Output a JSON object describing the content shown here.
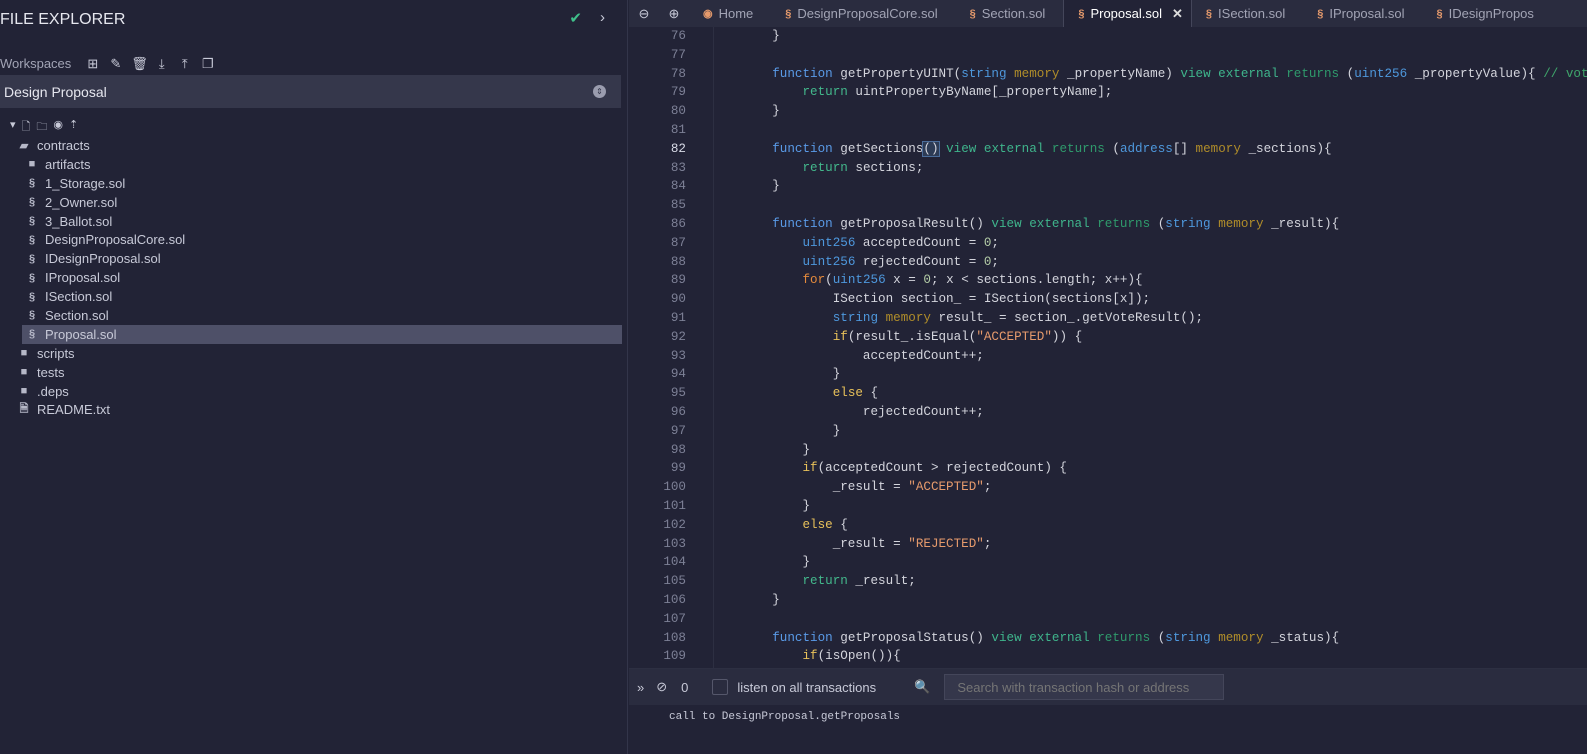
{
  "sidebar": {
    "title": "FILE EXPLORER",
    "workspaces_label": "Workspaces",
    "workspace": "Design Proposal",
    "tree": [
      {
        "label": "contracts",
        "type": "folder-open",
        "depth": 1
      },
      {
        "label": "artifacts",
        "type": "folder",
        "depth": 2
      },
      {
        "label": "1_Storage.sol",
        "type": "sol",
        "depth": 2
      },
      {
        "label": "2_Owner.sol",
        "type": "sol",
        "depth": 2
      },
      {
        "label": "3_Ballot.sol",
        "type": "sol",
        "depth": 2
      },
      {
        "label": "DesignProposalCore.sol",
        "type": "sol",
        "depth": 2
      },
      {
        "label": "IDesignProposal.sol",
        "type": "sol",
        "depth": 2
      },
      {
        "label": "IProposal.sol",
        "type": "sol",
        "depth": 2
      },
      {
        "label": "ISection.sol",
        "type": "sol",
        "depth": 2
      },
      {
        "label": "Section.sol",
        "type": "sol",
        "depth": 2
      },
      {
        "label": "Proposal.sol",
        "type": "sol",
        "depth": 2,
        "selected": true
      },
      {
        "label": "scripts",
        "type": "folder",
        "depth": 1
      },
      {
        "label": "tests",
        "type": "folder",
        "depth": 1
      },
      {
        "label": ".deps",
        "type": "folder",
        "depth": 1
      },
      {
        "label": "README.txt",
        "type": "file",
        "depth": 1
      }
    ]
  },
  "tabs": [
    {
      "label": "Home",
      "icon": "remix"
    },
    {
      "label": "DesignProposalCore.sol"
    },
    {
      "label": "Section.sol"
    },
    {
      "label": "Proposal.sol",
      "active": true
    },
    {
      "label": "ISection.sol"
    },
    {
      "label": "IProposal.sol"
    },
    {
      "label": "IDesignPropos"
    }
  ],
  "editor": {
    "current_line": 82,
    "lines": [
      {
        "n": 76,
        "t": [
          [
            "",
            "    }"
          ]
        ]
      },
      {
        "n": 77,
        "t": []
      },
      {
        "n": 78,
        "t": [
          [
            "",
            "    "
          ],
          [
            "k",
            "function"
          ],
          [
            "",
            " getPropertyUINT("
          ],
          [
            "t",
            "string"
          ],
          [
            "",
            " "
          ],
          [
            "mem",
            "memory"
          ],
          [
            "",
            " _propertyName) "
          ],
          [
            "m",
            "view external"
          ],
          [
            "",
            " "
          ],
          [
            "r",
            "returns"
          ],
          [
            "",
            " ("
          ],
          [
            "t",
            "uint256"
          ],
          [
            "",
            " _propertyValue){ "
          ],
          [
            "cm",
            "// vote"
          ]
        ]
      },
      {
        "n": 79,
        "t": [
          [
            "",
            "        "
          ],
          [
            "ret",
            "return"
          ],
          [
            "",
            " uintPropertyByName[_propertyName];"
          ]
        ]
      },
      {
        "n": 80,
        "t": [
          [
            "",
            "    }"
          ]
        ]
      },
      {
        "n": 81,
        "t": []
      },
      {
        "n": 82,
        "t": [
          [
            "",
            "    "
          ],
          [
            "k",
            "function"
          ],
          [
            "",
            " getSections"
          ],
          [
            "hl",
            "()"
          ],
          [
            "",
            " "
          ],
          [
            "m",
            "view external"
          ],
          [
            "",
            " "
          ],
          [
            "r",
            "returns"
          ],
          [
            "",
            " ("
          ],
          [
            "t",
            "address"
          ],
          [
            "",
            "[] "
          ],
          [
            "mem",
            "memory"
          ],
          [
            "",
            " _sections){"
          ]
        ]
      },
      {
        "n": 83,
        "t": [
          [
            "",
            "        "
          ],
          [
            "ret",
            "return"
          ],
          [
            "",
            " sections;"
          ]
        ]
      },
      {
        "n": 84,
        "t": [
          [
            "",
            "    }"
          ]
        ]
      },
      {
        "n": 85,
        "t": []
      },
      {
        "n": 86,
        "t": [
          [
            "",
            "    "
          ],
          [
            "k",
            "function"
          ],
          [
            "",
            " getProposalResult() "
          ],
          [
            "m",
            "view external"
          ],
          [
            "",
            " "
          ],
          [
            "r",
            "returns"
          ],
          [
            "",
            " ("
          ],
          [
            "t",
            "string"
          ],
          [
            "",
            " "
          ],
          [
            "mem",
            "memory"
          ],
          [
            "",
            " _result){"
          ]
        ]
      },
      {
        "n": 87,
        "t": [
          [
            "",
            "        "
          ],
          [
            "t",
            "uint256"
          ],
          [
            "",
            " acceptedCount = "
          ],
          [
            "n",
            "0"
          ],
          [
            "",
            ";"
          ]
        ]
      },
      {
        "n": 88,
        "t": [
          [
            "",
            "        "
          ],
          [
            "t",
            "uint256"
          ],
          [
            "",
            " rejectedCount = "
          ],
          [
            "n",
            "0"
          ],
          [
            "",
            ";"
          ]
        ]
      },
      {
        "n": 89,
        "t": [
          [
            "",
            "        "
          ],
          [
            "f",
            "for"
          ],
          [
            "",
            "("
          ],
          [
            "t",
            "uint256"
          ],
          [
            "",
            " x = "
          ],
          [
            "n",
            "0"
          ],
          [
            "",
            "; x < sections.length; x++){"
          ]
        ]
      },
      {
        "n": 90,
        "t": [
          [
            "",
            "            ISection section_ = ISection(sections[x]);"
          ]
        ]
      },
      {
        "n": 91,
        "t": [
          [
            "",
            "            "
          ],
          [
            "t",
            "string"
          ],
          [
            "",
            " "
          ],
          [
            "mem",
            "memory"
          ],
          [
            "",
            " result_ = section_.getVoteResult();"
          ]
        ]
      },
      {
        "n": 92,
        "t": [
          [
            "",
            "            "
          ],
          [
            "c",
            "if"
          ],
          [
            "",
            "(result_.isEqual("
          ],
          [
            "s",
            "\"ACCEPTED\""
          ],
          [
            "",
            ")) {"
          ]
        ]
      },
      {
        "n": 93,
        "t": [
          [
            "",
            "                acceptedCount++;"
          ]
        ]
      },
      {
        "n": 94,
        "t": [
          [
            "",
            "            }"
          ]
        ]
      },
      {
        "n": 95,
        "t": [
          [
            "",
            "            "
          ],
          [
            "c",
            "else"
          ],
          [
            "",
            " {"
          ]
        ]
      },
      {
        "n": 96,
        "t": [
          [
            "",
            "                rejectedCount++;"
          ]
        ]
      },
      {
        "n": 97,
        "t": [
          [
            "",
            "            }"
          ]
        ]
      },
      {
        "n": 98,
        "t": [
          [
            "",
            "        }"
          ]
        ]
      },
      {
        "n": 99,
        "t": [
          [
            "",
            "        "
          ],
          [
            "c",
            "if"
          ],
          [
            "",
            "(acceptedCount > rejectedCount) {"
          ]
        ]
      },
      {
        "n": 100,
        "t": [
          [
            "",
            "            _result = "
          ],
          [
            "s",
            "\"ACCEPTED\""
          ],
          [
            "",
            ";"
          ]
        ]
      },
      {
        "n": 101,
        "t": [
          [
            "",
            "        }"
          ]
        ]
      },
      {
        "n": 102,
        "t": [
          [
            "",
            "        "
          ],
          [
            "c",
            "else"
          ],
          [
            "",
            " {"
          ]
        ]
      },
      {
        "n": 103,
        "t": [
          [
            "",
            "            _result = "
          ],
          [
            "s",
            "\"REJECTED\""
          ],
          [
            "",
            ";"
          ]
        ]
      },
      {
        "n": 104,
        "t": [
          [
            "",
            "        }"
          ]
        ]
      },
      {
        "n": 105,
        "t": [
          [
            "",
            "        "
          ],
          [
            "ret",
            "return"
          ],
          [
            "",
            " _result;"
          ]
        ]
      },
      {
        "n": 106,
        "t": [
          [
            "",
            "    }"
          ]
        ]
      },
      {
        "n": 107,
        "t": []
      },
      {
        "n": 108,
        "t": [
          [
            "",
            "    "
          ],
          [
            "k",
            "function"
          ],
          [
            "",
            " getProposalStatus() "
          ],
          [
            "m",
            "view external"
          ],
          [
            "",
            " "
          ],
          [
            "r",
            "returns"
          ],
          [
            "",
            " ("
          ],
          [
            "t",
            "string"
          ],
          [
            "",
            " "
          ],
          [
            "mem",
            "memory"
          ],
          [
            "",
            " _status){"
          ]
        ]
      },
      {
        "n": 109,
        "t": [
          [
            "",
            "        "
          ],
          [
            "c",
            "if"
          ],
          [
            "",
            "(isOpen()){"
          ]
        ]
      }
    ]
  },
  "terminal": {
    "count": "0",
    "listen_label": "listen on all transactions",
    "search_placeholder": "Search with transaction hash or address",
    "log": "call to DesignProposal.getProposals"
  },
  "colors": {
    "check": "#3fbf8a",
    "selected_row": "#4e5068",
    "background": "#222336"
  }
}
